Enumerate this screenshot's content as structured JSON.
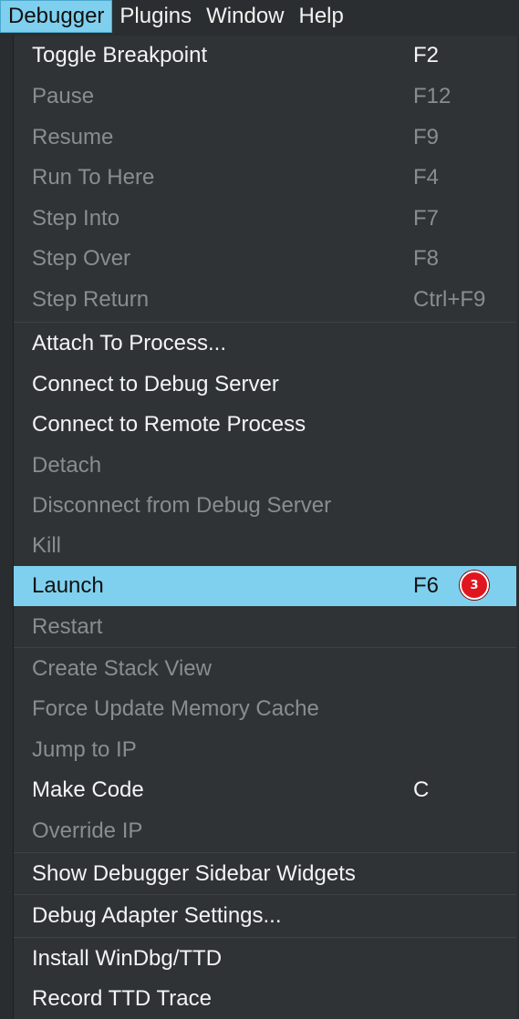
{
  "menubar": {
    "debugger": "Debugger",
    "plugins": "Plugins",
    "window": "Window",
    "help": "Help"
  },
  "menu": {
    "items": [
      {
        "label": "Toggle Breakpoint",
        "shortcut": "F2",
        "enabled": true
      },
      {
        "label": "Pause",
        "shortcut": "F12",
        "enabled": false
      },
      {
        "label": "Resume",
        "shortcut": "F9",
        "enabled": false
      },
      {
        "label": "Run To Here",
        "shortcut": "F4",
        "enabled": false
      },
      {
        "label": "Step Into",
        "shortcut": "F7",
        "enabled": false
      },
      {
        "label": "Step Over",
        "shortcut": "F8",
        "enabled": false
      },
      {
        "label": "Step Return",
        "shortcut": "Ctrl+F9",
        "enabled": false
      },
      {
        "label": "Attach To Process...",
        "shortcut": "",
        "enabled": true
      },
      {
        "label": "Connect to Debug Server",
        "shortcut": "",
        "enabled": true
      },
      {
        "label": "Connect to Remote Process",
        "shortcut": "",
        "enabled": true
      },
      {
        "label": "Detach",
        "shortcut": "",
        "enabled": false
      },
      {
        "label": "Disconnect from Debug Server",
        "shortcut": "",
        "enabled": false
      },
      {
        "label": "Kill",
        "shortcut": "",
        "enabled": false
      },
      {
        "label": "Launch",
        "shortcut": "F6",
        "enabled": true,
        "highlighted": true
      },
      {
        "label": "Restart",
        "shortcut": "",
        "enabled": false
      },
      {
        "label": "Create Stack View",
        "shortcut": "",
        "enabled": false
      },
      {
        "label": "Force Update Memory Cache",
        "shortcut": "",
        "enabled": false
      },
      {
        "label": "Jump to IP",
        "shortcut": "",
        "enabled": false
      },
      {
        "label": "Make Code",
        "shortcut": "C",
        "enabled": true
      },
      {
        "label": "Override IP",
        "shortcut": "",
        "enabled": false
      },
      {
        "label": "Show Debugger Sidebar Widgets",
        "shortcut": "",
        "enabled": true
      },
      {
        "label": "Debug Adapter Settings...",
        "shortcut": "",
        "enabled": true
      },
      {
        "label": "Install WinDbg/TTD",
        "shortcut": "",
        "enabled": true
      },
      {
        "label": "Record TTD Trace",
        "shortcut": "",
        "enabled": true
      }
    ]
  },
  "annotation": {
    "badge": "3",
    "badge_color": "#e0161f"
  },
  "colors": {
    "highlight": "#7fd0ee",
    "menu_bg": "#2f3336",
    "enabled_text": "#f4f4f4",
    "disabled_text": "#8a8d8f"
  }
}
